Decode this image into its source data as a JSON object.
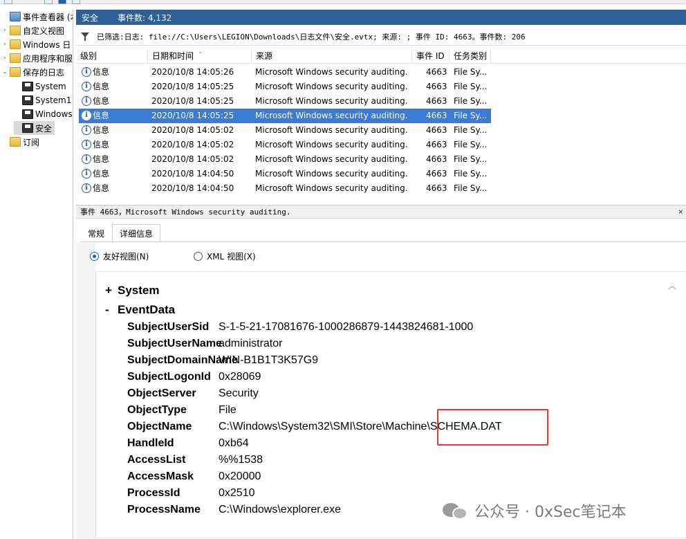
{
  "tree": {
    "items": [
      {
        "label": "事件查看器 (本地",
        "icon": "event-viewer-icon",
        "arrow": ""
      },
      {
        "label": "自定义视图",
        "icon": "folder-icon",
        "arrow": "›"
      },
      {
        "label": "Windows 日",
        "icon": "folder-icon",
        "arrow": "›"
      },
      {
        "label": "应用程序和服",
        "icon": "folder-icon",
        "arrow": "›"
      },
      {
        "label": "保存的日志",
        "icon": "folder-icon",
        "arrow": "⌄"
      },
      {
        "label": "System",
        "icon": "log-file-icon",
        "arrow": ""
      },
      {
        "label": "System1",
        "icon": "log-file-icon",
        "arrow": ""
      },
      {
        "label": "Windows",
        "icon": "log-file-icon",
        "arrow": ""
      },
      {
        "label": "安全",
        "icon": "log-file-icon",
        "arrow": ""
      },
      {
        "label": "订阅",
        "icon": "subscription-icon",
        "arrow": ""
      }
    ]
  },
  "header": {
    "log_name": "安全",
    "event_count": "事件数: 4,132"
  },
  "filter": {
    "text": "已筛选:日志: file://C:\\Users\\LEGION\\Downloads\\日志文件\\安全.evtx; 来源: ; 事件 ID: 4663。事件数: 206"
  },
  "grid": {
    "columns": [
      "级别",
      "日期和时间",
      "来源",
      "事件 ID",
      "任务类别"
    ],
    "rows": [
      {
        "level": "信息",
        "datetime": "2020/10/8 14:05:26",
        "source": "Microsoft Windows security auditing.",
        "id": "4663",
        "task": "File Sy..."
      },
      {
        "level": "信息",
        "datetime": "2020/10/8 14:05:25",
        "source": "Microsoft Windows security auditing.",
        "id": "4663",
        "task": "File Sy..."
      },
      {
        "level": "信息",
        "datetime": "2020/10/8 14:05:25",
        "source": "Microsoft Windows security auditing.",
        "id": "4663",
        "task": "File Sy..."
      },
      {
        "level": "信息",
        "datetime": "2020/10/8 14:05:25",
        "source": "Microsoft Windows security auditing.",
        "id": "4663",
        "task": "File Sy..."
      },
      {
        "level": "信息",
        "datetime": "2020/10/8 14:05:02",
        "source": "Microsoft Windows security auditing.",
        "id": "4663",
        "task": "File Sy..."
      },
      {
        "level": "信息",
        "datetime": "2020/10/8 14:05:02",
        "source": "Microsoft Windows security auditing.",
        "id": "4663",
        "task": "File Sy..."
      },
      {
        "level": "信息",
        "datetime": "2020/10/8 14:05:02",
        "source": "Microsoft Windows security auditing.",
        "id": "4663",
        "task": "File Sy..."
      },
      {
        "level": "信息",
        "datetime": "2020/10/8 14:04:50",
        "source": "Microsoft Windows security auditing.",
        "id": "4663",
        "task": "File Sy..."
      },
      {
        "level": "信息",
        "datetime": "2020/10/8 14:04:50",
        "source": "Microsoft Windows security auditing.",
        "id": "4663",
        "task": "File Sy..."
      }
    ],
    "selected_row": 3
  },
  "detail": {
    "title": "事件 4663，Microsoft Windows security auditing.",
    "close": "×",
    "tabs": [
      "常规",
      "详细信息"
    ],
    "active_tab": 1,
    "radio_friendly": "友好视图(N)",
    "radio_xml": "XML 视图(X)",
    "system_label": "System",
    "system_toggle": "+",
    "eventdata_label": "EventData",
    "eventdata_toggle": "-",
    "fields": [
      {
        "key": "SubjectUserSid",
        "value": "S-1-5-21-17081676-1000286879-1443824681-1000"
      },
      {
        "key": "SubjectUserName",
        "value": "administrator"
      },
      {
        "key": "SubjectDomainName",
        "value": "WIN-B1B1T3K57G9"
      },
      {
        "key": "SubjectLogonId",
        "value": "0x28069"
      },
      {
        "key": "ObjectServer",
        "value": "Security"
      },
      {
        "key": "ObjectType",
        "value": "File"
      },
      {
        "key": "ObjectName",
        "value": "C:\\Windows\\System32\\SMI\\Store\\Machine\\SCHEMA.DAT"
      },
      {
        "key": "HandleId",
        "value": "0xb64"
      },
      {
        "key": "AccessList",
        "value": "%%1538"
      },
      {
        "key": "AccessMask",
        "value": "0x20000"
      },
      {
        "key": "ProcessId",
        "value": "0x2510"
      },
      {
        "key": "ProcessName",
        "value": "C:\\Windows\\explorer.exe"
      }
    ]
  },
  "watermark": {
    "text": "公众号 · 0xSec笔记本"
  },
  "colors": {
    "header_bg": "#2e5f96",
    "selection": "#3a7bd5",
    "highlight_box": "#e53935"
  }
}
